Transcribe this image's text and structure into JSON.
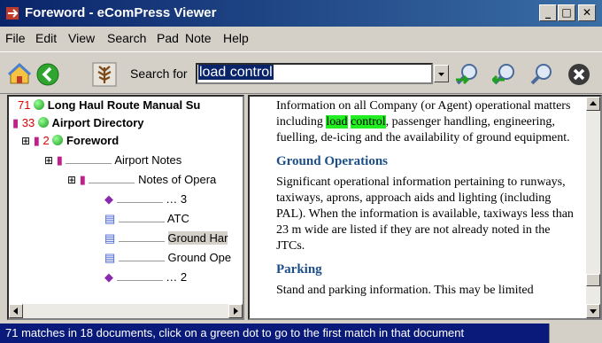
{
  "window": {
    "title": "Foreword - eComPress Viewer",
    "controls": {
      "minimize": "_",
      "maximize": "□",
      "close": "✕"
    }
  },
  "menu": [
    "File",
    "Edit",
    "View",
    "Search",
    "Pad",
    "Note",
    "Help"
  ],
  "toolbar": {
    "search_label": "Search for",
    "search_value": "load control",
    "icons": [
      "home-icon",
      "back-arrow-icon",
      "tree-view-icon",
      "zoom-in-icon",
      "zoom-out-icon",
      "search-icon",
      "close-icon"
    ]
  },
  "tree": [
    {
      "count": "71",
      "label": "Long Haul Route Manual Su"
    },
    {
      "count": "33",
      "label": "Airport Directory"
    },
    {
      "count": "2",
      "label": "Foreword",
      "expander": "⊞"
    },
    {
      "label": "Airport Notes",
      "expander": "⊞"
    },
    {
      "label": "Notes of Opera",
      "expander": "⊞"
    },
    {
      "label": "… 3"
    },
    {
      "label": "ATC"
    },
    {
      "label": "Ground Har"
    },
    {
      "label": "Ground Ope"
    },
    {
      "label": "… 2"
    }
  ],
  "document": {
    "p1_before": "Information on all Company (or Agent) operational matters including ",
    "hl1": "load",
    "hl_space": " ",
    "hl2": "control",
    "p1_after": ", passenger handling, engineering, fuelling, de-icing and the availability of ground equipment.",
    "h_ground": "Ground Operations",
    "p2": "Significant operational information pertaining to runways, taxiways, aprons, approach aids and lighting (including PAL). When the information is available, taxiways less than 23  m wide are listed if they are not already noted in the JTCs.",
    "h_parking": "Parking",
    "p3": "Stand and parking information. This may be limited"
  },
  "status": {
    "message": "71 matches in 18 documents, click on a green dot to go to the first match in that document"
  },
  "colors": {
    "titlebar": "#0a246a",
    "highlight": "#22ee22",
    "heading": "#1c4f8a",
    "count": "#e00000",
    "status_bg": "#0a1a7a"
  }
}
